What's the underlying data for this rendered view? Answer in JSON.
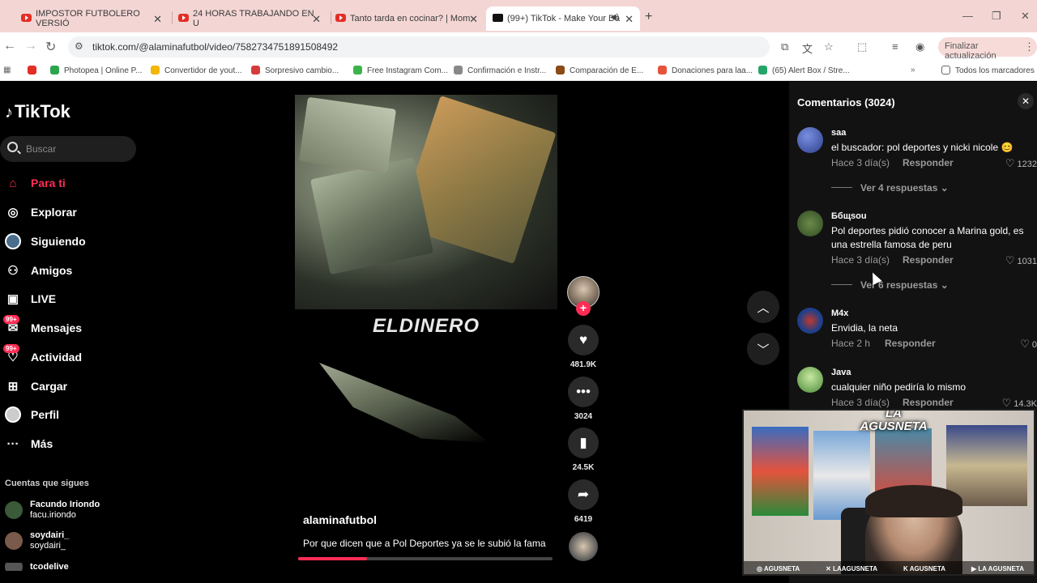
{
  "browser": {
    "tabs": [
      {
        "title": "IMPOSTOR FUTBOLERO VERSIÓ"
      },
      {
        "title": "24 HORAS TRABAJANDO EN U"
      },
      {
        "title": "Tanto tarda en cocinar? | Mom"
      },
      {
        "title": "(99+) TikTok - Make Your Da"
      }
    ],
    "url": "tiktok.com/@alaminafutbol/video/7582734751891508492",
    "update_label": "Finalizar actualización",
    "bookmarks": [
      {
        "label": "Photopea | Online P...",
        "color": "#2da44e"
      },
      {
        "label": "Convertidor de yout...",
        "color": "#f2b705"
      },
      {
        "label": "Sorpresivo cambio...",
        "color": "#d63b3b"
      },
      {
        "label": "Free Instagram Com...",
        "color": "#3bb34a"
      },
      {
        "label": "Confirmación e Instr...",
        "color": "#888888"
      },
      {
        "label": "Comparación de E...",
        "color": "#8a4b14"
      },
      {
        "label": "Donaciones para laa...",
        "color": "#e5533d"
      },
      {
        "label": "(65) Alert Box / Stre...",
        "color": "#25a56a"
      }
    ],
    "all_bookmarks_label": "Todos los marcadores"
  },
  "sidebar": {
    "logo": "TikTok",
    "search_placeholder": "Buscar",
    "nav": [
      {
        "label": "Para ti",
        "icon": "home-icon"
      },
      {
        "label": "Explorar",
        "icon": "compass-icon"
      },
      {
        "label": "Siguiendo",
        "icon": "following-icon"
      },
      {
        "label": "Amigos",
        "icon": "friends-icon"
      },
      {
        "label": "LIVE",
        "icon": "live-icon"
      },
      {
        "label": "Mensajes",
        "icon": "messages-icon",
        "badge": "99+"
      },
      {
        "label": "Actividad",
        "icon": "activity-icon",
        "badge": "99+"
      },
      {
        "label": "Cargar",
        "icon": "upload-icon"
      },
      {
        "label": "Perfil",
        "icon": "profile-icon"
      },
      {
        "label": "Más",
        "icon": "more-icon"
      }
    ],
    "following_header": "Cuentas que sigues",
    "following": [
      {
        "name": "Facundo Iriondo",
        "handle": "facu.iriondo"
      },
      {
        "name": "soydairi_",
        "handle": "soydairi_"
      },
      {
        "name": "tcodelive",
        "handle": ""
      }
    ]
  },
  "video": {
    "overlay_text": "ELDINERO",
    "author": "alaminafutbol",
    "description": "Por que dicen que a Pol Deportes ya se le subió la fama",
    "progress": 0.27,
    "likes": "481.9K",
    "comments": "3024",
    "saves": "24.5K",
    "shares": "6419"
  },
  "comments_panel": {
    "title": "Comentarios (3024)",
    "comments": [
      {
        "user": "saa",
        "text": "el buscador: pol deportes y nicki nicole 😊",
        "time": "Hace 3 día(s)",
        "reply": "Responder",
        "likes": "1232",
        "more": "Ver 4 respuestas",
        "avatar_color": "#4a62b8"
      },
      {
        "user": "Ббщsou",
        "text": "Pol deportes pidió conocer a Marina gold, es una estrella famosa de peru",
        "time": "Hace 3 día(s)",
        "reply": "Responder",
        "likes": "1031",
        "more": "Ver 6 respuestas",
        "avatar_color": "#3d5a32"
      },
      {
        "user": "M4x",
        "text": "Envidia, la neta",
        "time": "Hace 2 h",
        "reply": "Responder",
        "likes": "0",
        "more": "",
        "avatar_color": "#274a8c"
      },
      {
        "user": "Java",
        "text": "cualquier niño pediría lo mismo",
        "time": "Hace 3 día(s)",
        "reply": "Responder",
        "likes": "14.3K",
        "more": "",
        "avatar_color": "#5c9c4a"
      }
    ]
  },
  "webcam": {
    "logo": "LA AGUSNETA",
    "socials": [
      "AGUSNETA",
      "LAAGUSNETA",
      "AGUSNETA",
      "LA AGUSNETA"
    ]
  }
}
